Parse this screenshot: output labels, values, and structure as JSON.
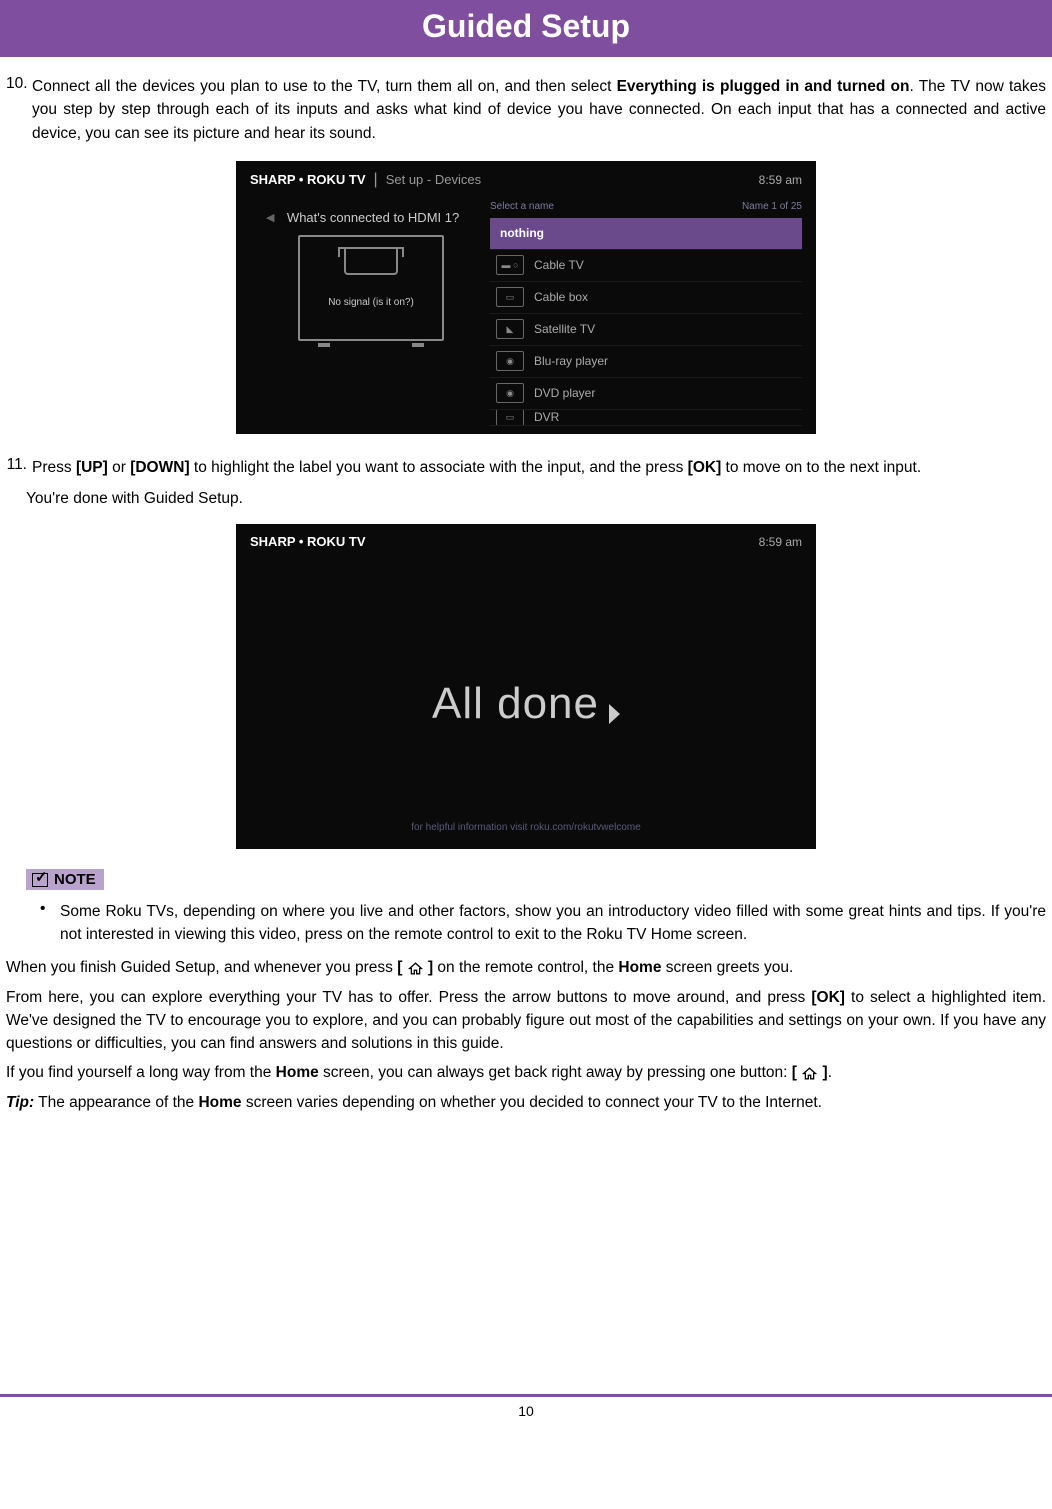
{
  "header": {
    "title": "Guided Setup"
  },
  "step10": {
    "num": "10.",
    "t1": "Connect all the devices you plan to use to the TV, turn them all on, and then select ",
    "b1": "Everything is plugged in and turned on",
    "t2": ". The TV now takes you step by step through each of its inputs and asks what kind of device you have connected. On each input that has a connected and active device, you can see its picture and hear its sound."
  },
  "tv1": {
    "brand": "SHARP • ROKU TV",
    "crumb": "Set up - Devices",
    "time": "8:59 am",
    "prompt": "What's connected to HDMI 1?",
    "nosignal": "No signal (is it on?)",
    "selhdr_l": "Select a name",
    "selhdr_r": "Name 1 of 25",
    "options": [
      "nothing",
      "Cable TV",
      "Cable box",
      "Satellite TV",
      "Blu-ray player",
      "DVD player",
      "DVR"
    ]
  },
  "step11": {
    "num": "11.",
    "t1": "Press ",
    "b1": "[UP]",
    "t2": " or ",
    "b2": "[DOWN]",
    "t3": " to highlight the label you want to associate with the input, and the press ",
    "b3": "[OK]",
    "t4": " to move on to the next input.",
    "done": "You're done with Guided Setup."
  },
  "tv2": {
    "brand": "SHARP • ROKU TV",
    "time": "8:59 am",
    "main": "All done",
    "helper": "for helpful information visit roku.com/rokutvwelcome"
  },
  "note": {
    "label": "NOTE",
    "bullet": "Some Roku TVs, depending on where you live and other factors, show you an introductory video filled with some great hints and tips. If you're not interested in viewing this video, press on the remote control to exit to the Roku TV Home screen."
  },
  "p1": {
    "t1": "When you finish Guided Setup, and whenever you press ",
    "b1": "[ ",
    "b2": " ]",
    "t2": " on the remote control, the ",
    "b3": "Home",
    "t3": " screen greets you."
  },
  "p2": {
    "t1": "From here, you can explore everything your TV has to offer. Press the arrow buttons to move around, and press ",
    "b1": "[OK]",
    "t2": " to select a highlighted item. We've designed the TV to encourage you to explore, and you can probably figure out most of the capabilities and settings on your own. If you have any questions or difficulties, you can find answers and solutions in this guide."
  },
  "p3": {
    "t1": "If you find yourself a long way from the ",
    "b1": "Home",
    "t2": " screen, you can always get back right away by pressing one button: ",
    "b2": "[ ",
    "b3": " ]",
    "t3": "."
  },
  "p4": {
    "b1": "Tip:",
    "t1": " The appearance of the ",
    "b2": "Home",
    "t2": " screen varies depending on whether you decided to connect your TV to the Internet."
  },
  "footer": {
    "page": "10"
  }
}
